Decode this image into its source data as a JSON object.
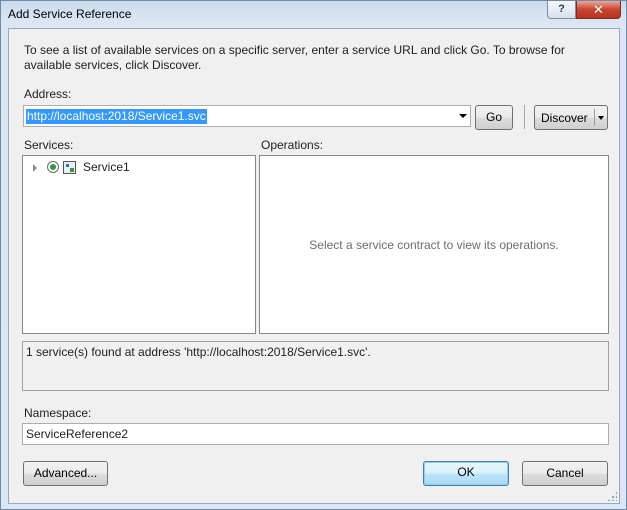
{
  "window": {
    "title": "Add Service Reference",
    "help_label": "?",
    "close_label": "✕"
  },
  "intro": {
    "text": "To see a list of available services on a specific server, enter a service URL and click Go. To browse for available services, click Discover."
  },
  "address": {
    "label": "Address:",
    "value": "http://localhost:2018/Service1.svc",
    "go_label": "Go",
    "discover_label": "Discover"
  },
  "services": {
    "label": "Services:",
    "items": [
      {
        "label": "Service1",
        "icon": "service-reference-icon"
      }
    ]
  },
  "operations": {
    "label": "Operations:",
    "placeholder": "Select a service contract to view its operations."
  },
  "status": {
    "text": "1 service(s) found at address 'http://localhost:2018/Service1.svc'."
  },
  "namespace": {
    "label": "Namespace:",
    "value": "ServiceReference2"
  },
  "buttons": {
    "advanced": "Advanced...",
    "ok": "OK",
    "cancel": "Cancel"
  },
  "colors": {
    "selection": "#3399ff",
    "ok_border": "#3c7fb1",
    "close_button": "#c8452f"
  }
}
